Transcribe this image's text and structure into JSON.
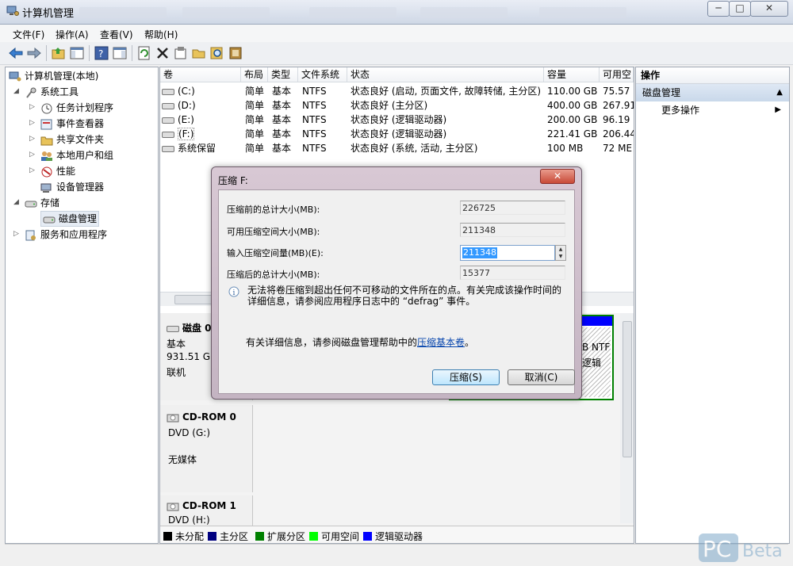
{
  "window": {
    "title": "计算机管理",
    "min": "─",
    "max": "□",
    "close": "✕"
  },
  "menu": [
    "文件(F)",
    "操作(A)",
    "查看(V)",
    "帮助(H)"
  ],
  "tree": {
    "root": "计算机管理(本地)",
    "system_tools": "系统工具",
    "task_scheduler": "任务计划程序",
    "event_viewer": "事件查看器",
    "shared_folders": "共享文件夹",
    "local_users": "本地用户和组",
    "performance": "性能",
    "device_manager": "设备管理器",
    "storage": "存储",
    "disk_management": "磁盘管理",
    "services_apps": "服务和应用程序"
  },
  "volumes": {
    "headers": [
      "卷",
      "布局",
      "类型",
      "文件系统",
      "状态",
      "容量",
      "可用空"
    ],
    "rows": [
      [
        "(C:)",
        "简单",
        "基本",
        "NTFS",
        "状态良好 (启动, 页面文件, 故障转储, 主分区)",
        "110.00 GB",
        "75.57"
      ],
      [
        "(D:)",
        "简单",
        "基本",
        "NTFS",
        "状态良好 (主分区)",
        "400.00 GB",
        "267.91"
      ],
      [
        "(E:)",
        "简单",
        "基本",
        "NTFS",
        "状态良好 (逻辑驱动器)",
        "200.00 GB",
        "96.19"
      ],
      [
        "(F:)",
        "简单",
        "基本",
        "NTFS",
        "状态良好 (逻辑驱动器)",
        "221.41 GB",
        "206.44"
      ],
      [
        "系统保留",
        "简单",
        "基本",
        "NTFS",
        "状态良好 (系统, 活动, 主分区)",
        "100 MB",
        "72 ME"
      ]
    ]
  },
  "disks": {
    "disk0": {
      "name": "磁盘 0",
      "type": "基本",
      "size": "931.51 GE",
      "status": "联机",
      "frag1": "B NTF",
      "frag2": "逻辑"
    },
    "cd0": {
      "name": "CD-ROM 0",
      "drive": "DVD (G:)",
      "media": "无媒体"
    },
    "cd1": {
      "name": "CD-ROM 1",
      "drive": "DVD (H:)"
    }
  },
  "legend": [
    {
      "label": "未分配",
      "color": "#000000"
    },
    {
      "label": "主分区",
      "color": "#000080"
    },
    {
      "label": "扩展分区",
      "color": "#008000"
    },
    {
      "label": "可用空间",
      "color": "#00ff00"
    },
    {
      "label": "逻辑驱动器",
      "color": "#0000ff"
    }
  ],
  "actions": {
    "header": "操作",
    "section": "磁盘管理",
    "more": "更多操作"
  },
  "dialog": {
    "title": "压缩 F:",
    "close": "✕",
    "total_before_label": "压缩前的总计大小(MB):",
    "total_before": "226725",
    "available_label": "可用压缩空间大小(MB):",
    "available": "211348",
    "input_label": "输入压缩空间量(MB)(E):",
    "input_value": "211348",
    "total_after_label": "压缩后的总计大小(MB):",
    "total_after": "15377",
    "info": "无法将卷压缩到超出任何不可移动的文件所在的点。有关完成该操作时间的详细信息，请参阅应用程序日志中的 “defrag” 事件。",
    "help_prefix": "有关详细信息，请参阅磁盘管理帮助中的",
    "help_link": "压缩基本卷",
    "help_suffix": "。",
    "ok": "压缩(S)",
    "cancel": "取消(C)"
  },
  "watermark": "Beta"
}
